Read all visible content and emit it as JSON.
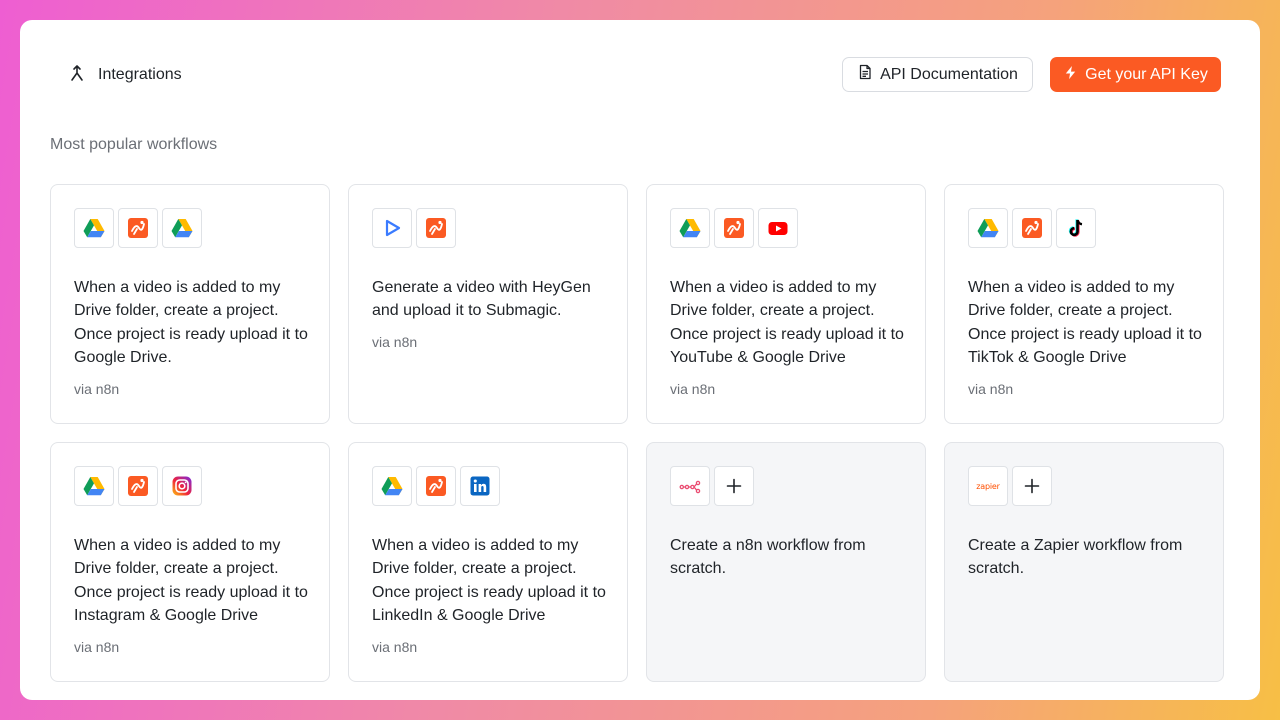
{
  "header": {
    "title": "Integrations",
    "api_docs_label": "API Documentation",
    "get_key_label": "Get your API Key"
  },
  "section_title": "Most popular workflows",
  "colors": {
    "accent": "#fb5a23",
    "panel_bg": "#ffffff",
    "scratch_bg": "#f5f6f8"
  },
  "cards": [
    {
      "icons": [
        "google-drive-icon",
        "submagic-icon",
        "google-drive-icon"
      ],
      "text": "When a video is added to my Drive folder, create a project. Once project is ready upload it to Google Drive.",
      "via": "via n8n"
    },
    {
      "icons": [
        "heygen-icon",
        "submagic-icon"
      ],
      "text": "Generate a video with HeyGen and upload it to Submagic.",
      "via": "via n8n"
    },
    {
      "icons": [
        "google-drive-icon",
        "submagic-icon",
        "youtube-icon"
      ],
      "text": "When a video is added to my Drive folder, create a project. Once project is ready upload it to YouTube & Google Drive",
      "via": "via n8n"
    },
    {
      "icons": [
        "google-drive-icon",
        "submagic-icon",
        "tiktok-icon"
      ],
      "text": "When a video is added to my Drive folder, create a project. Once project is ready upload it to TikTok & Google Drive",
      "via": "via n8n"
    },
    {
      "icons": [
        "google-drive-icon",
        "submagic-icon",
        "instagram-icon"
      ],
      "text": "When a video is added to my Drive folder, create a project. Once project is ready upload it to Instagram & Google Drive",
      "via": "via n8n"
    },
    {
      "icons": [
        "google-drive-icon",
        "submagic-icon",
        "linkedin-icon"
      ],
      "text": "When a video is added to my Drive folder, create a project. Once project is ready upload it to LinkedIn & Google Drive",
      "via": "via n8n"
    },
    {
      "icons": [
        "n8n-icon",
        "plus-icon"
      ],
      "text": "Create a n8n workflow from scratch.",
      "via": ""
    },
    {
      "icons": [
        "zapier-icon",
        "plus-icon"
      ],
      "text": "Create a Zapier workflow from scratch.",
      "via": ""
    }
  ],
  "zapier_logo_text": "zapier"
}
